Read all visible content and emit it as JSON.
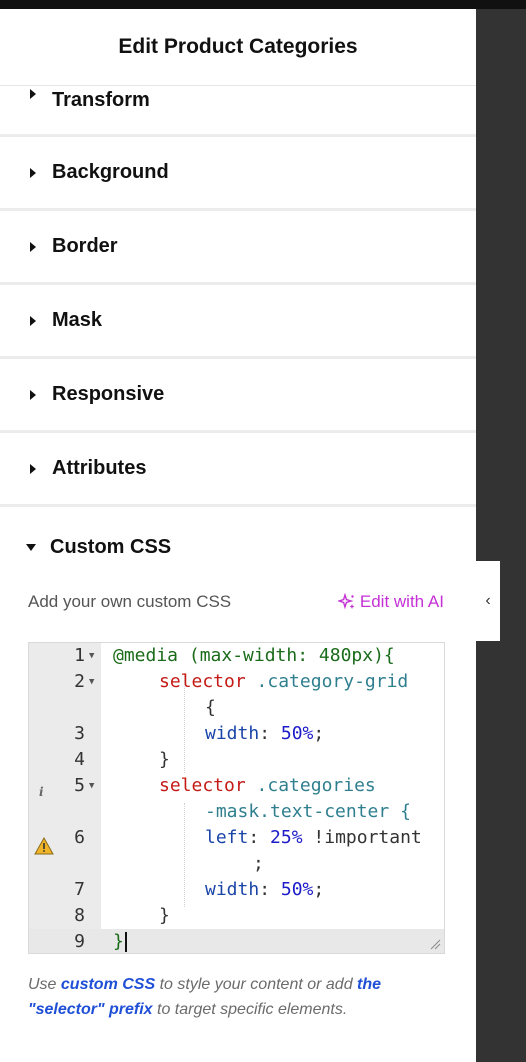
{
  "header": {
    "title": "Edit Product Categories"
  },
  "sections": [
    {
      "label": "Transform"
    },
    {
      "label": "Background"
    },
    {
      "label": "Border"
    },
    {
      "label": "Mask"
    },
    {
      "label": "Responsive"
    },
    {
      "label": "Attributes"
    }
  ],
  "custom_css": {
    "title": "Custom CSS",
    "description": "Add your own custom CSS",
    "ai_label": "Edit with AI",
    "note_prefix": "Use ",
    "note_link1": "custom CSS",
    "note_mid": " to style your content or add ",
    "note_link2": "the \"selector\" prefix",
    "note_suffix": " to target specific elements."
  },
  "editor": {
    "line_numbers": [
      "1",
      "2",
      "3",
      "4",
      "5",
      "6",
      "7",
      "8",
      "9"
    ],
    "l1": "@media (max-width: 480px){",
    "l2a": "selector",
    "l2b": ".category-grid",
    "l2c": "{",
    "l3a": "width",
    "l3b": ": ",
    "l3c": "50%",
    "l3d": ";",
    "l4": "}",
    "l5a": "selector",
    "l5b": ".categories",
    "l5c": "-mask.text-center {",
    "l6a": "left",
    "l6b": ": ",
    "l6c": "25%",
    "l6d": " !important",
    "l6e": ";",
    "l7a": "width",
    "l7b": ": ",
    "l7c": "50%",
    "l7d": ";",
    "l8": "}",
    "l9": "}"
  },
  "panel_toggle": {
    "glyph": "‹"
  },
  "colors": {
    "accent_ai": "#c531d6",
    "link": "#1f4fd6",
    "warning": "#f0b429"
  }
}
